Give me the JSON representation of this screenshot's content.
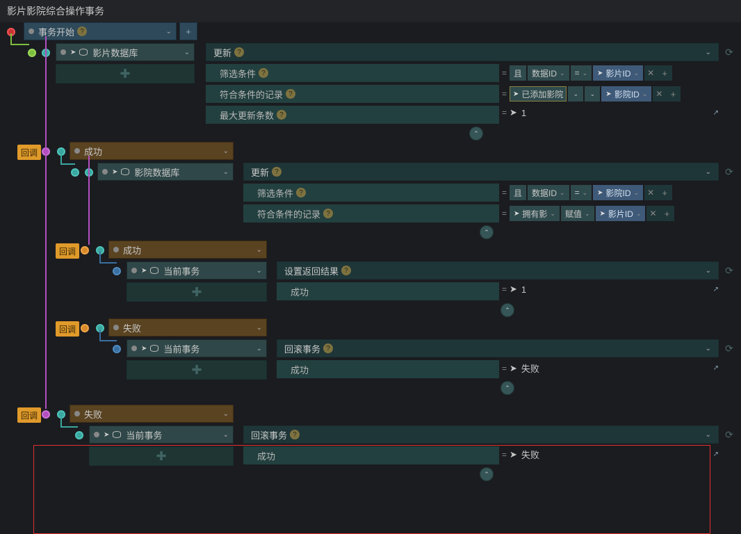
{
  "title": "影片影院综合操作事务",
  "start": {
    "label": "事务开始",
    "help": "?"
  },
  "cb": "回调",
  "nodes": {
    "movieDb": "影片数据库",
    "cinemaDb": "影院数据库",
    "curTrans": "当前事务",
    "success": "成功",
    "fail": "失败"
  },
  "actions": {
    "update": "更新",
    "setResult": "设置返回结果",
    "rollback": "回滚事务"
  },
  "params": {
    "filter": "筛选条件",
    "matched": "符合条件的记录",
    "maxRows": "最大更新条数",
    "successP": "成功"
  },
  "vals": {
    "and": "且",
    "dataId": "数据ID",
    "movieId": "影片ID",
    "cinemaId": "影院ID",
    "addedCinema": "已添加影院",
    "ownMovie": "拥有影",
    "assign": "赋值",
    "one": "1",
    "failV": "失败",
    "eq": "="
  }
}
